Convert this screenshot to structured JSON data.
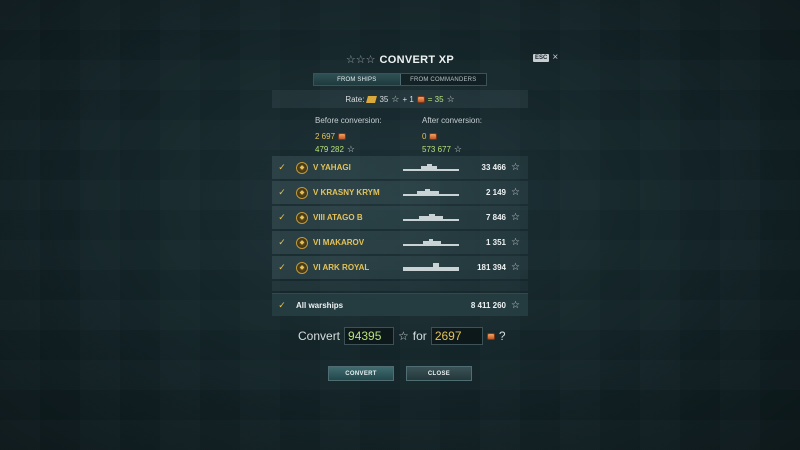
{
  "dialog": {
    "title": "CONVERT XP",
    "icons": {
      "title": "stars-icon",
      "close": "close-icon"
    },
    "esc_key": "ESC",
    "tabs": [
      {
        "label": "FROM SHIPS",
        "active": true
      },
      {
        "label": "FROM COMMANDERS",
        "active": false
      }
    ],
    "rate": {
      "label": "Rate:",
      "xp_amount": "35",
      "plus": "+ 1",
      "equals": "= 35"
    },
    "before": {
      "label": "Before conversion:",
      "doubloons": "2 697",
      "free_xp": "479 282"
    },
    "after": {
      "label": "After conversion:",
      "doubloons": "0",
      "free_xp": "573 677"
    },
    "ships": [
      {
        "name": "V YAHAGI",
        "xp": "33 466"
      },
      {
        "name": "V KRASNY KRYM",
        "xp": "2 149"
      },
      {
        "name": "VIII ATAGO B",
        "xp": "7 846"
      },
      {
        "name": "VI MAKAROV",
        "xp": "1 351"
      },
      {
        "name": "VI ARK ROYAL",
        "xp": "181 394"
      }
    ],
    "all_warships": {
      "label": "All warships",
      "xp": "8 411 260"
    },
    "convert_line": {
      "convert": "Convert",
      "xp_value": "94395",
      "for": "for",
      "doubloon_value": "2697",
      "question": "?"
    },
    "buttons": {
      "convert": "CONVERT",
      "close": "CLOSE"
    },
    "colors": {
      "gold": "#e3c25a",
      "green": "#b6e07a",
      "background": "#122327"
    }
  }
}
